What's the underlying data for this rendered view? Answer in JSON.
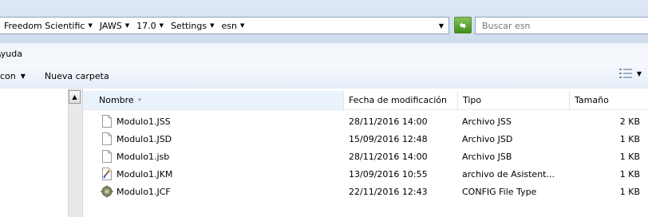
{
  "address_bar": {
    "breadcrumbs": [
      "Freedom Scientific",
      "JAWS",
      "17.0",
      "Settings",
      "esn"
    ],
    "search_placeholder": "Buscar esn"
  },
  "menu_bar": {
    "items": [
      "Ayuda"
    ]
  },
  "command_bar": {
    "items": [
      "con",
      "Nueva carpeta"
    ]
  },
  "file_list": {
    "columns": [
      "Nombre",
      "Fecha de modificación",
      "Tipo",
      "Tamaño"
    ],
    "sort_column": "Nombre",
    "rows": [
      {
        "name": "Modulo1.JSS",
        "modified": "28/11/2016 14:00",
        "type": "Archivo JSS",
        "size": "2 KB",
        "icon": "blank-file-icon"
      },
      {
        "name": "Modulo1.JSD",
        "modified": "15/09/2016 12:48",
        "type": "Archivo JSD",
        "size": "1 KB",
        "icon": "blank-file-icon"
      },
      {
        "name": "Modulo1.jsb",
        "modified": "28/11/2016 14:00",
        "type": "Archivo JSB",
        "size": "1 KB",
        "icon": "blank-file-icon"
      },
      {
        "name": "Modulo1.JKM",
        "modified": "13/09/2016 10:55",
        "type": "archivo de Asistent...",
        "size": "1 KB",
        "icon": "wizard-file-icon"
      },
      {
        "name": "Modulo1.JCF",
        "modified": "22/11/2016 12:43",
        "type": "CONFIG File Type",
        "size": "1 KB",
        "icon": "config-file-icon"
      }
    ]
  }
}
